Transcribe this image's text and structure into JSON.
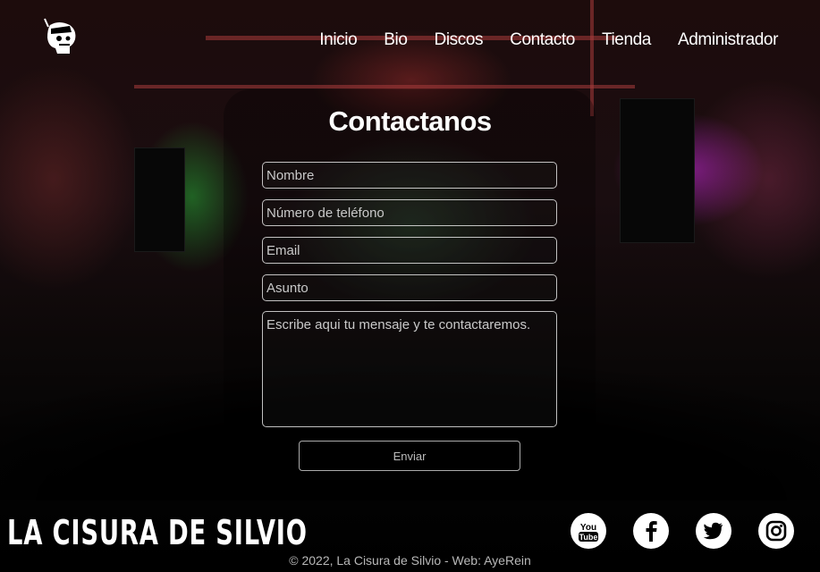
{
  "nav": {
    "items": [
      {
        "label": "Inicio"
      },
      {
        "label": "Bio"
      },
      {
        "label": "Discos"
      },
      {
        "label": "Contacto"
      },
      {
        "label": "Tienda"
      },
      {
        "label": "Administrador"
      }
    ]
  },
  "form": {
    "title": "Contactanos",
    "fields": {
      "nombre": "Nombre",
      "telefono": "Número de teléfono",
      "email": "Email",
      "asunto": "Asunto",
      "mensaje": "Escribe aqui tu mensaje y te contactaremos."
    },
    "submit_label": "Enviar"
  },
  "footer": {
    "brand": "LA CISURA DE SILVIO",
    "socials": [
      {
        "icon": "youtube-icon",
        "text": "You Tube"
      },
      {
        "icon": "facebook-icon"
      },
      {
        "icon": "twitter-icon"
      },
      {
        "icon": "instagram-icon"
      }
    ],
    "copyright": "© 2022, La Cisura de Silvio - Web:  AyeRein"
  }
}
